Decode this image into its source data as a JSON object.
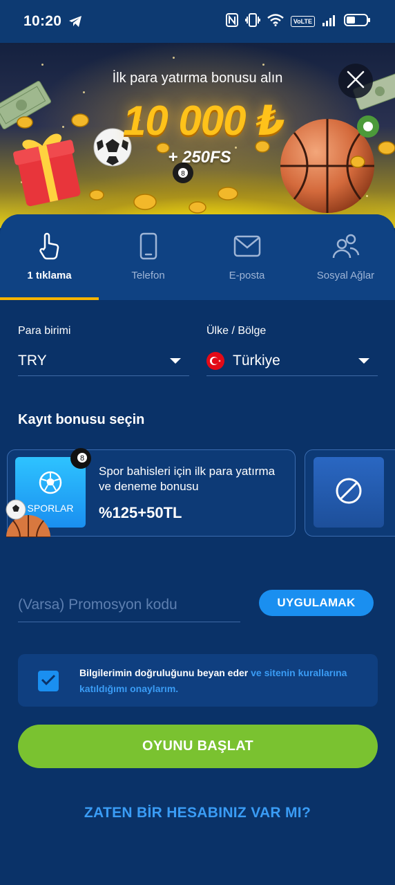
{
  "status_bar": {
    "time": "10:20",
    "volte": "VoLTE"
  },
  "banner": {
    "title": "İlk para yatırma bonusu alın",
    "amount": "10 000 ₺",
    "free_spins": "+ 250FS"
  },
  "tabs": [
    {
      "label": "1 tıklama",
      "icon": "pointer-hand-icon",
      "active": true
    },
    {
      "label": "Telefon",
      "icon": "phone-icon",
      "active": false
    },
    {
      "label": "E-posta",
      "icon": "envelope-icon",
      "active": false
    },
    {
      "label": "Sosyal Ağlar",
      "icon": "users-icon",
      "active": false
    }
  ],
  "currency": {
    "label": "Para birimi",
    "value": "TRY"
  },
  "country": {
    "label": "Ülke / Bölge",
    "value": "Türkiye"
  },
  "bonus_section": {
    "title": "Kayıt bonusu seçin",
    "selected": {
      "image_label": "SPORLAR",
      "description": "Spor bahisleri için ilk para yatırma ve deneme bonusu",
      "value": "%125+50TL"
    }
  },
  "promo": {
    "placeholder": "(Varsa) Promosyon kodu",
    "apply_label": "UYGULAMAK"
  },
  "consent": {
    "checked": true,
    "text_plain": "Bilgilerimin doğruluğunu beyan eder ",
    "text_link": "ve sitenin kurallarına katıldığımı onaylarım."
  },
  "start_button": "OYUNU BAŞLAT",
  "login_link": "ZATEN BİR HESABINIZ VAR MI?",
  "colors": {
    "background": "#0a3268",
    "tabs_bg": "#0f4283",
    "accent_blue": "#1a8ff0",
    "link_blue": "#3a9cf5",
    "start_green": "#7ac230",
    "active_tab_indicator": "#f5b400",
    "bonus_amount": "#ffc21a"
  }
}
